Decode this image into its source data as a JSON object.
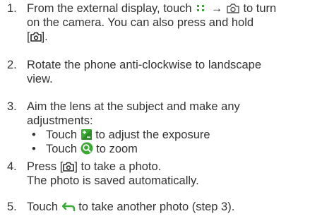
{
  "steps": [
    {
      "number": "1.",
      "line1_a": "From the external display, touch",
      "arrow": "→",
      "line1_b": "to turn",
      "line2": "on the camera. You can also press and hold",
      "line3_a": "[",
      "line3_b": "].",
      "icons": [
        "apps-grid-icon",
        "camera-icon",
        "camera-key-icon"
      ]
    },
    {
      "number": "2.",
      "line1": "Rotate the phone anti-clockwise to landscape",
      "line2": "view."
    },
    {
      "number": "3.",
      "line1": "Aim the lens at the subject and make any",
      "line2": "adjustments:",
      "bullets": [
        {
          "pre": "Touch",
          "post": "to adjust the exposure",
          "icon": "exposure-icon"
        },
        {
          "pre": "Touch",
          "post": "to zoom",
          "icon": "zoom-icon"
        }
      ]
    },
    {
      "number": "4.",
      "line1_a": "Press [",
      "line1_b": "] to take a photo.",
      "line2": "The photo is saved automatically.",
      "icon": "camera-key-icon"
    },
    {
      "number": "5.",
      "line1_a": "Touch",
      "line1_b": "to take another photo (step 3).",
      "icon": "back-arrow-icon"
    }
  ],
  "colors": {
    "text": "#333333",
    "icon_dark": "#2a2a2a",
    "icon_gray": "#555555",
    "accent_green": "#3aaa35"
  }
}
